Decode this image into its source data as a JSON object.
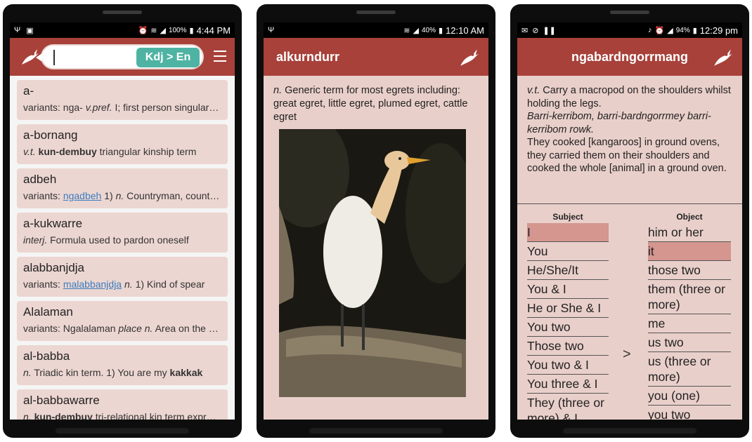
{
  "phone1": {
    "status": {
      "battery": "100%",
      "time": "4:44 PM"
    },
    "search": {
      "value": "",
      "direction_button": "Kdj > En"
    },
    "entries": [
      {
        "headword": "a-",
        "def": [
          {
            "t": "variants: nga- ",
            "s": ""
          },
          {
            "t": "v.pref.",
            "s": "it"
          },
          {
            "t": " I; first person singular subject prefix",
            "s": ""
          }
        ]
      },
      {
        "headword": "a-bornang",
        "def": [
          {
            "t": "v.t.",
            "s": "it"
          },
          {
            "t": " ",
            "s": ""
          },
          {
            "t": "kun-dembuy",
            "s": "b"
          },
          {
            "t": " triangular kinship term",
            "s": ""
          }
        ]
      },
      {
        "headword": "adbeh",
        "def": [
          {
            "t": "variants: ",
            "s": ""
          },
          {
            "t": "ngadbeh",
            "s": "link"
          },
          {
            "t": "  1) ",
            "s": ""
          },
          {
            "t": "n.",
            "s": "it"
          },
          {
            "t": " Countryman, countrywoman",
            "s": ""
          }
        ]
      },
      {
        "headword": "a-kukwarre",
        "def": [
          {
            "t": "interj.",
            "s": "it"
          },
          {
            "t": " Formula used to pardon oneself",
            "s": ""
          }
        ]
      },
      {
        "headword": "alabbanjdja",
        "def": [
          {
            "t": "variants: ",
            "s": ""
          },
          {
            "t": "malabbanjdja",
            "s": "link"
          },
          {
            "t": " ",
            "s": ""
          },
          {
            "t": "n.",
            "s": "it"
          },
          {
            "t": "  1) Kind of spear",
            "s": ""
          }
        ]
      },
      {
        "headword": "Alalaman",
        "def": [
          {
            "t": "variants: Ngalalaman ",
            "s": ""
          },
          {
            "t": "place n.",
            "s": "it"
          },
          {
            "t": " Area on the river",
            "s": ""
          }
        ]
      },
      {
        "headword": "al-babba",
        "def": [
          {
            "t": "n.",
            "s": "it"
          },
          {
            "t": " Triadic kin term. 1) You are my ",
            "s": ""
          },
          {
            "t": "kakkak",
            "s": "b"
          }
        ]
      },
      {
        "headword": "al-babbawarre",
        "def": [
          {
            "t": "n.",
            "s": "it"
          },
          {
            "t": " ",
            "s": ""
          },
          {
            "t": "kun-dembuy",
            "s": "b"
          },
          {
            "t": " tri-relational kin term expressing",
            "s": ""
          }
        ]
      }
    ]
  },
  "phone2": {
    "status": {
      "battery": "40%",
      "time": "12:10 AM"
    },
    "title": "alkurndurr",
    "pos": "n.",
    "definition": "Generic term for most egrets including: great egret, little egret, plumed egret, cattle egret"
  },
  "phone3": {
    "status": {
      "battery": "94%",
      "time": "12:29 pm"
    },
    "title": "ngabardngorrmang",
    "pos": "v.t.",
    "gloss": "Carry a macropod on the shoulders whilst holding the legs.",
    "example_kdj": "Barri-kerribom, barri-bardngorrmey barri-kerribom rowk.",
    "example_en": "They cooked [kangaroos] in ground ovens, they carried them on their shoulders and cooked the whole [animal] in a ground oven.",
    "subject_header": "Subject",
    "object_header": "Object",
    "arrow": ">",
    "subjects": [
      "I",
      "You",
      "He/She/It",
      "You & I",
      "He or She & I",
      "You two",
      "Those two",
      "You two & I",
      "You three & I",
      "They (three or more) & I"
    ],
    "objects": [
      "him or her",
      "it",
      "those two",
      "them (three or more)",
      "me",
      "us two",
      "us (three or more)",
      "you (one)",
      "you two"
    ],
    "selected_subject": 0,
    "selected_object": 1
  }
}
